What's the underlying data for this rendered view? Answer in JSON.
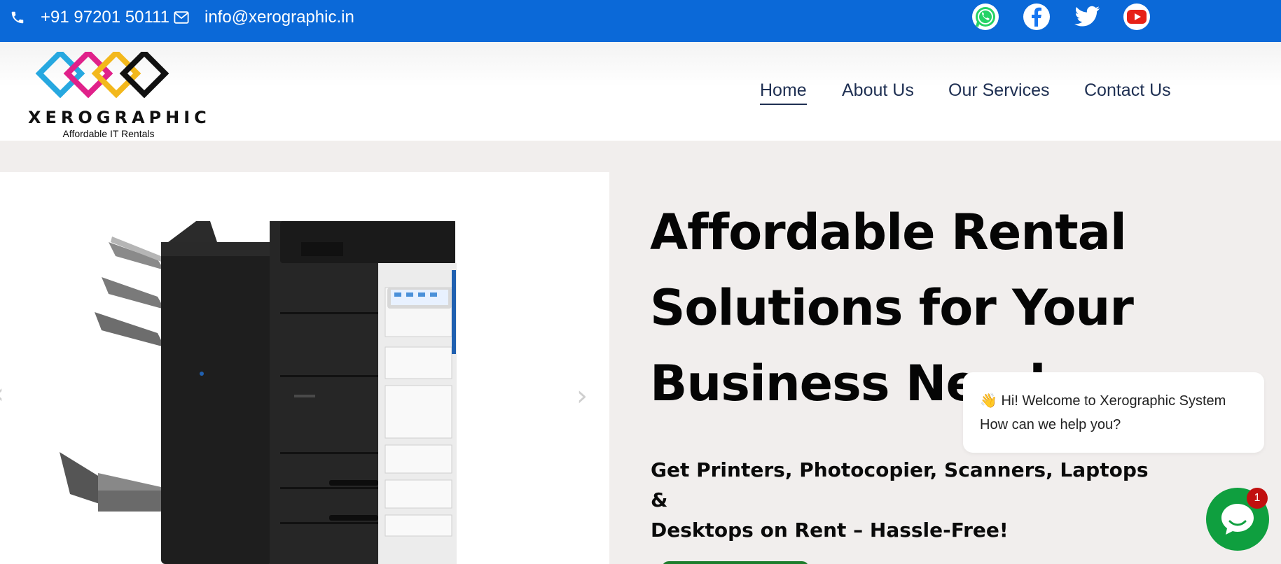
{
  "topbar": {
    "phone": "+91 97201 50111",
    "email": "info@xerographic.in",
    "social": [
      "whatsapp-icon",
      "facebook-icon",
      "twitter-icon",
      "youtube-icon"
    ],
    "color": "#0b69d8"
  },
  "logo": {
    "name": "XEROGRAPHIC",
    "tagline": "Affordable IT Rentals",
    "colors": [
      "#27a8e0",
      "#e0218a",
      "#f3b81c",
      "#111111"
    ]
  },
  "nav": {
    "items": [
      "Home",
      "About Us",
      "Our Services",
      "Contact Us"
    ],
    "active": "Home"
  },
  "hero": {
    "title_line1": "Affordable Rental",
    "title_line2": "Solutions for Your",
    "title_line3": "Business Needs",
    "subtitle_line1": "Get Printers, Photocopier, Scanners, Laptops &",
    "subtitle_line2": "Desktops on Rent – Hassle-Free!",
    "image": "photocopier-image"
  },
  "chat": {
    "line1": "👋 Hi! Welcome to Xerographic System",
    "line2": "How can we help you?",
    "badge": "1",
    "color": "#0f9f3f"
  }
}
